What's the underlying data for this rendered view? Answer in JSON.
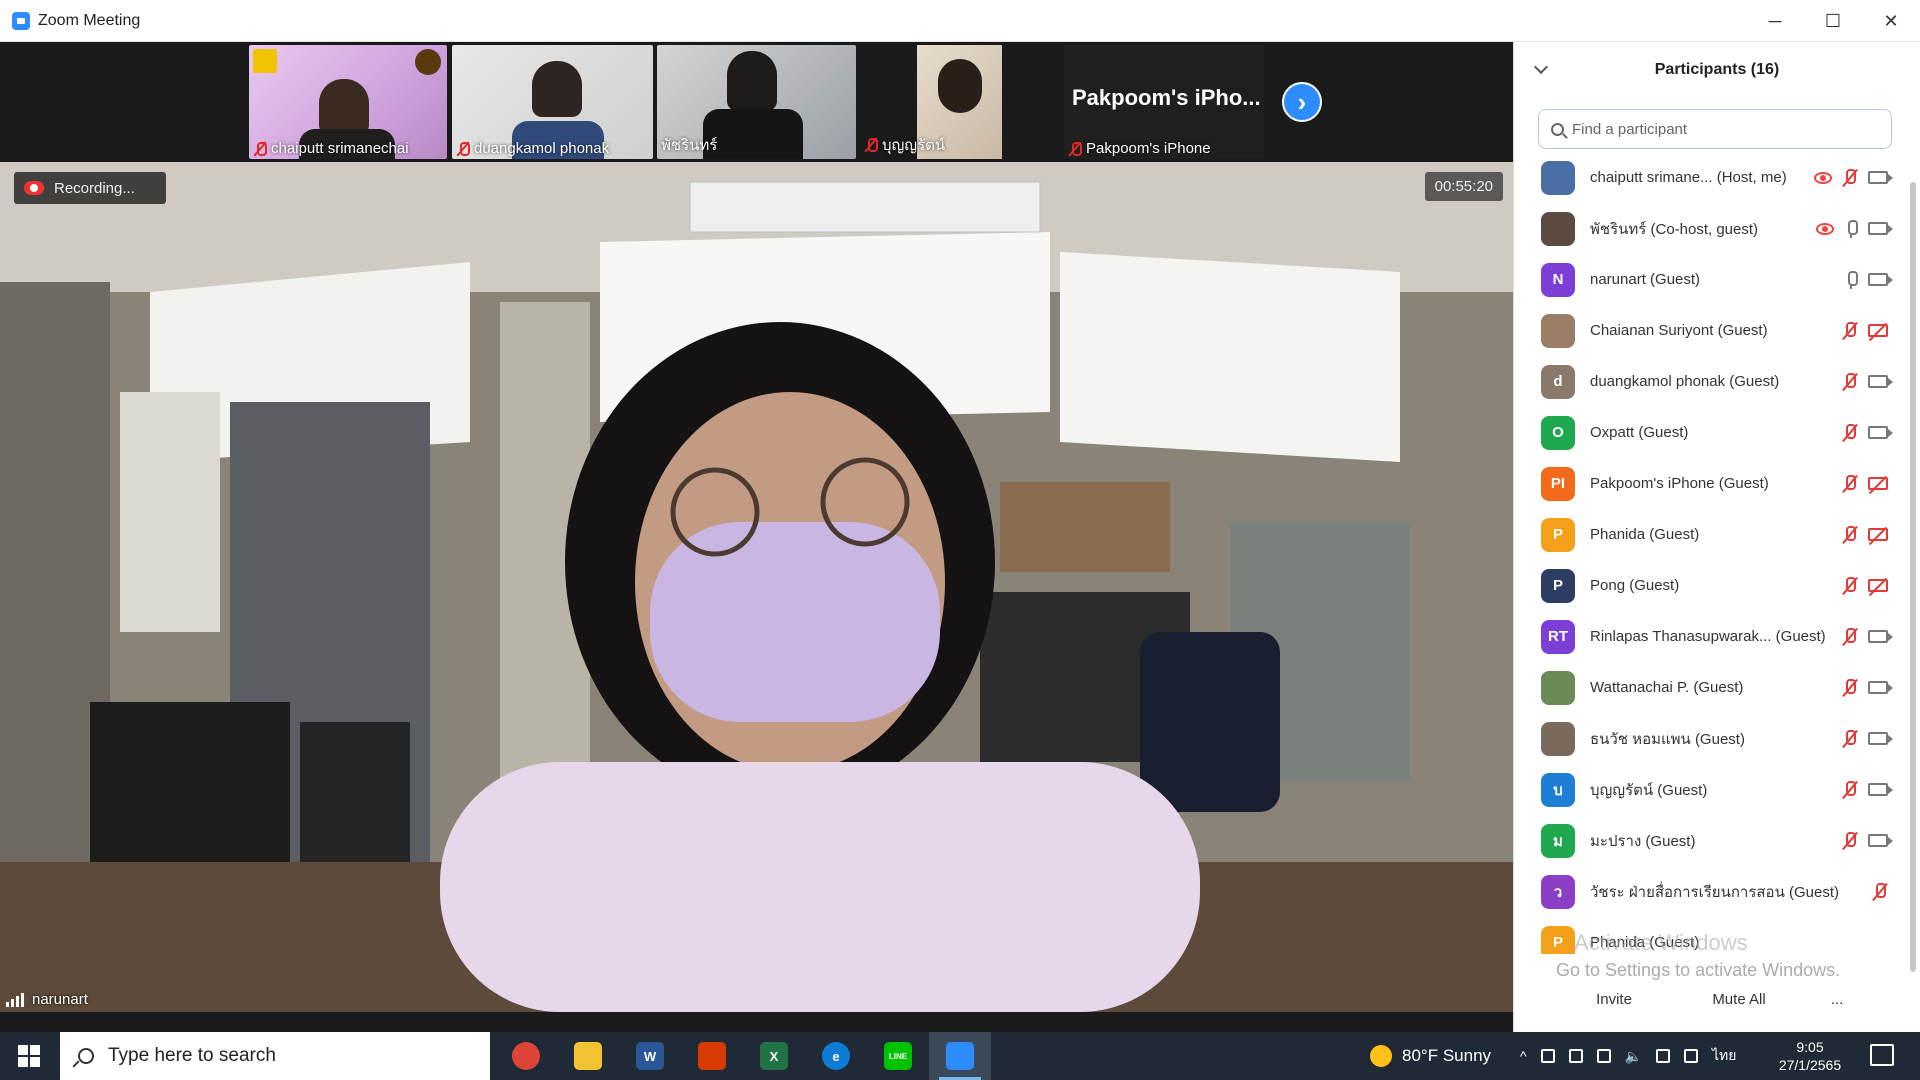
{
  "window": {
    "title": "Zoom Meeting",
    "controls": {
      "minimize": "─",
      "maximize": "☐",
      "close": "✕"
    }
  },
  "gallery": {
    "thumbnails": [
      {
        "name": "chaiputt srimanechai"
      },
      {
        "name": "duangkamol phonak"
      },
      {
        "name": "พัชรินทร์"
      },
      {
        "name": "บุญญรัตน์"
      },
      {
        "name": "Pakpoom's iPhone",
        "title": "Pakpoom's iPho..."
      }
    ],
    "next_icon": "chevron-right-icon"
  },
  "main_video": {
    "recording_label": "Recording...",
    "timer": "00:55:20",
    "speaker": "narunart"
  },
  "panel": {
    "title": "Participants (16)",
    "search_placeholder": "Find a participant",
    "participants": [
      {
        "initials": "",
        "color": "#4a6fa5",
        "name": "chaiputt srimane... (Host, me)",
        "recording": true,
        "mic": "off",
        "cam": "on"
      },
      {
        "initials": "",
        "color": "#5b4a3f",
        "name": "พัชรินทร์ (Co-host, guest)",
        "recording": true,
        "mic": "on",
        "cam": "on"
      },
      {
        "initials": "N",
        "color": "#7b3fd6",
        "name": "narunart (Guest)",
        "recording": false,
        "mic": "on",
        "cam": "on"
      },
      {
        "initials": "",
        "color": "#9a7e66",
        "name": "Chaianan Suriyont (Guest)",
        "recording": false,
        "mic": "off",
        "cam": "off"
      },
      {
        "initials": "d",
        "color": "#8a7a6c",
        "name": "duangkamol phonak (Guest)",
        "recording": false,
        "mic": "off",
        "cam": "on"
      },
      {
        "initials": "O",
        "color": "#20a84e",
        "name": "Oxpatt (Guest)",
        "recording": false,
        "mic": "off",
        "cam": "on"
      },
      {
        "initials": "PI",
        "color": "#f26b1d",
        "name": "Pakpoom's iPhone (Guest)",
        "recording": false,
        "mic": "off",
        "cam": "off"
      },
      {
        "initials": "P",
        "color": "#f5a01a",
        "name": "Phanida (Guest)",
        "recording": false,
        "mic": "off",
        "cam": "off"
      },
      {
        "initials": "P",
        "color": "#2c3e64",
        "name": "Pong (Guest)",
        "recording": false,
        "mic": "off",
        "cam": "off"
      },
      {
        "initials": "RT",
        "color": "#7b3fd6",
        "name": "Rinlapas Thanasupwarak... (Guest)",
        "recording": false,
        "mic": "off",
        "cam": "on"
      },
      {
        "initials": "",
        "color": "#6b8a55",
        "name": "Wattanachai P. (Guest)",
        "recording": false,
        "mic": "off",
        "cam": "on"
      },
      {
        "initials": "",
        "color": "#7a6a5d",
        "name": "ธนวัช หอมแพน (Guest)",
        "recording": false,
        "mic": "off",
        "cam": "on"
      },
      {
        "initials": "บ",
        "color": "#1f7fd4",
        "name": "บุญญรัตน์ (Guest)",
        "recording": false,
        "mic": "off",
        "cam": "on"
      },
      {
        "initials": "ม",
        "color": "#20a84e",
        "name": "มะปราง (Guest)",
        "recording": false,
        "mic": "off",
        "cam": "on"
      },
      {
        "initials": "ว",
        "color": "#8a3fc6",
        "name": "วัชระ ฝ่ายสื่อการเรียนการสอน (Guest)",
        "recording": false,
        "mic": "off",
        "cam": "none"
      },
      {
        "initials": "P",
        "color": "#f5a01a",
        "name": "Phanida (Guest)",
        "recording": false,
        "mic": "none",
        "cam": "none"
      }
    ],
    "watermark_title": "Activate Windows",
    "watermark_sub": "Go to Settings to activate Windows.",
    "invite_label": "Invite",
    "mute_all_label": "Mute All",
    "more_label": "..."
  },
  "taskbar": {
    "search_placeholder": "Type here to search",
    "apps": [
      {
        "name": "chrome",
        "color": "#db4437",
        "label": ""
      },
      {
        "name": "file-explorer",
        "color": "#f2c230",
        "label": ""
      },
      {
        "name": "word",
        "color": "#2b5797",
        "label": "W"
      },
      {
        "name": "office",
        "color": "#d83b01",
        "label": ""
      },
      {
        "name": "excel",
        "color": "#217346",
        "label": "X"
      },
      {
        "name": "edge",
        "color": "#0c7cd5",
        "label": "e"
      },
      {
        "name": "line",
        "color": "#00c300",
        "label": "LINE"
      },
      {
        "name": "zoom",
        "color": "#2d8cff",
        "label": ""
      }
    ],
    "weather": "80°F Sunny",
    "language": "ไทย",
    "time": "9:05",
    "date": "27/1/2565"
  }
}
